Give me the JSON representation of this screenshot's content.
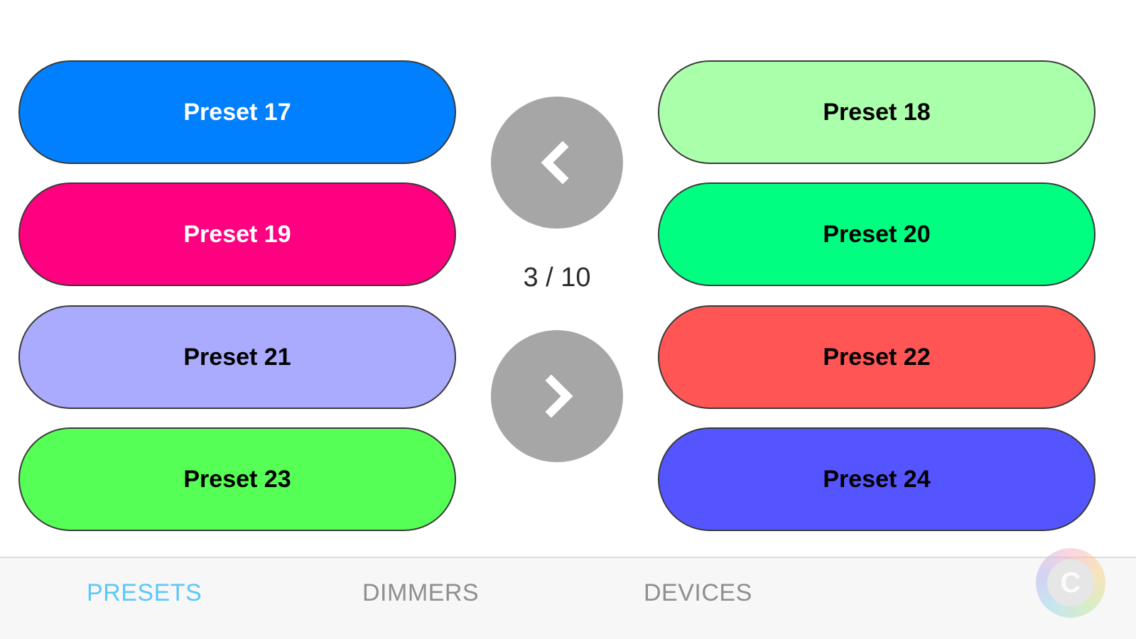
{
  "presets": [
    {
      "label": "Preset 17",
      "bg": "#0080FF",
      "fg": "#FFFFFF"
    },
    {
      "label": "Preset 18",
      "bg": "#AAFFAA",
      "fg": "#000000"
    },
    {
      "label": "Preset 19",
      "bg": "#FF0080",
      "fg": "#FFFFFF"
    },
    {
      "label": "Preset 20",
      "bg": "#00FF80",
      "fg": "#000000"
    },
    {
      "label": "Preset 21",
      "bg": "#AAAAFF",
      "fg": "#000000"
    },
    {
      "label": "Preset 22",
      "bg": "#FF5555",
      "fg": "#000000"
    },
    {
      "label": "Preset 23",
      "bg": "#55FF55",
      "fg": "#000000"
    },
    {
      "label": "Preset 24",
      "bg": "#5555FF",
      "fg": "#000000"
    }
  ],
  "pager": {
    "text": "3 / 10",
    "prev_icon": "chevron-left-icon",
    "next_icon": "chevron-right-icon",
    "button_color": "#A6A6A6"
  },
  "tabs": [
    {
      "label": "PRESETS",
      "active": true,
      "color": "#5AC8FA"
    },
    {
      "label": "DIMMERS",
      "active": false,
      "color": "#8E8E93"
    },
    {
      "label": "DEVICES",
      "active": false,
      "color": "#8E8E93"
    }
  ],
  "badge": {
    "letter": "C",
    "icon": "watermark-badge-icon"
  }
}
